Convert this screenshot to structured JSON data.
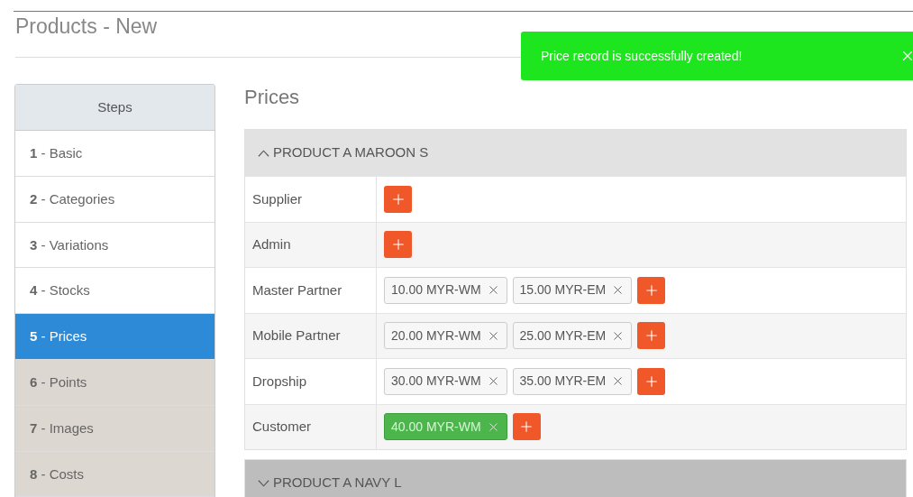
{
  "page": {
    "title": "Products - New"
  },
  "toast": {
    "message": "Price record is successfully created!"
  },
  "steps": {
    "title": "Steps",
    "items": [
      {
        "label": "**1** - Basic",
        "selected": false,
        "disabled": false
      },
      {
        "label": "**2** - Categories",
        "selected": false,
        "disabled": false
      },
      {
        "label": "**3** - Variations",
        "selected": false,
        "disabled": false
      },
      {
        "label": "**4** - Stocks",
        "selected": false,
        "disabled": false
      },
      {
        "label": "**5** - Prices",
        "selected": true,
        "disabled": false
      },
      {
        "label": "**6** - Points",
        "selected": false,
        "disabled": true
      },
      {
        "label": "**7** - Images",
        "selected": false,
        "disabled": true
      },
      {
        "label": "**8** - Costs",
        "selected": false,
        "disabled": true
      }
    ]
  },
  "prices": {
    "heading": "Prices",
    "sections": [
      {
        "title": "PRODUCT A MAROON S",
        "expanded": true,
        "rows": [
          {
            "label": "Supplier"
          },
          {
            "label": "Admin"
          },
          {
            "label": "Master Partner",
            "tags": [
              {
                "text": "10.00 MYR-WM",
                "highlighted": false
              },
              {
                "text": "15.00 MYR-EM",
                "highlighted": false
              }
            ]
          },
          {
            "label": "Mobile Partner",
            "tags": [
              {
                "text": "20.00 MYR-WM",
                "highlighted": false
              },
              {
                "text": "25.00 MYR-EM",
                "highlighted": false
              }
            ]
          },
          {
            "label": "Dropship",
            "tags": [
              {
                "text": "30.00 MYR-WM",
                "highlighted": false
              },
              {
                "text": "35.00 MYR-EM",
                "highlighted": false
              }
            ]
          },
          {
            "label": "Customer",
            "tags": [
              {
                "text": "40.00 MYR-WM",
                "highlighted": true
              }
            ]
          }
        ]
      },
      {
        "title": "PRODUCT A NAVY L",
        "expanded": false
      }
    ]
  }
}
